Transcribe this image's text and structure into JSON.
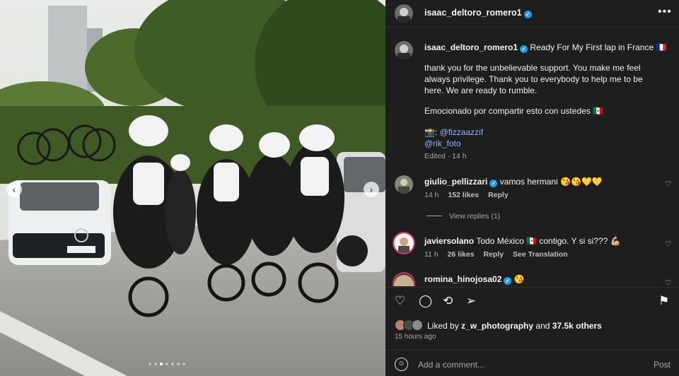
{
  "photo": {
    "description_icon": "team-time-trial-photo",
    "carousel_dots_count": 7,
    "carousel_active_index": 2
  },
  "post": {
    "username": "isaac_deltoro_romero1",
    "more_icon": "•••",
    "caption_text": "Ready For My First lap in France 🇫🇷",
    "caption_body": "thank you for the unbelievable support. You make me feel always privilege. Thank you to everybody to help me to be here. We are ready to rumble.",
    "caption_spanish": "Emocionado por compartir esto con ustedes 🇲🇽",
    "camera_emoji": "📸:",
    "mention1": "@fizzaazzif",
    "mention2": "@rik_foto",
    "edited": "Edited · 14 h"
  },
  "comments": [
    {
      "username": "giulio_pellizzari",
      "verified": true,
      "text": "vamos hermani 😘😘💛💛",
      "time": "14 h",
      "likes": "152 likes",
      "reply": "Reply",
      "view_replies": "View replies (1)"
    },
    {
      "username": "javiersolano",
      "verified": false,
      "text": "Todo México 🇲🇽 contigo. Y si si??? 💪🏼",
      "time": "11 h",
      "likes": "26 likes",
      "reply": "Reply",
      "translate": "See Translation"
    },
    {
      "username": "romina_hinojosa02",
      "verified": true,
      "text": "😘"
    }
  ],
  "actions": {
    "like_icon": "♡",
    "comment_icon": "◯",
    "repost_icon": "⟲",
    "share_icon": "➢",
    "save_icon": "⚑"
  },
  "likes": {
    "liked_by_prefix": "Liked by",
    "liked_by_user": "z_w_photography",
    "and_text": "and",
    "others": "37.5k others",
    "time": "15 hours ago"
  },
  "comment_box": {
    "emoji_icon": "☺",
    "placeholder": "Add a comment...",
    "post_label": "Post"
  },
  "colors": {
    "panel_bg": "#1e1e1e",
    "verified_blue": "#1d9bf0",
    "link_blue": "#8fb4ff",
    "story_ring": "#d3315c"
  }
}
